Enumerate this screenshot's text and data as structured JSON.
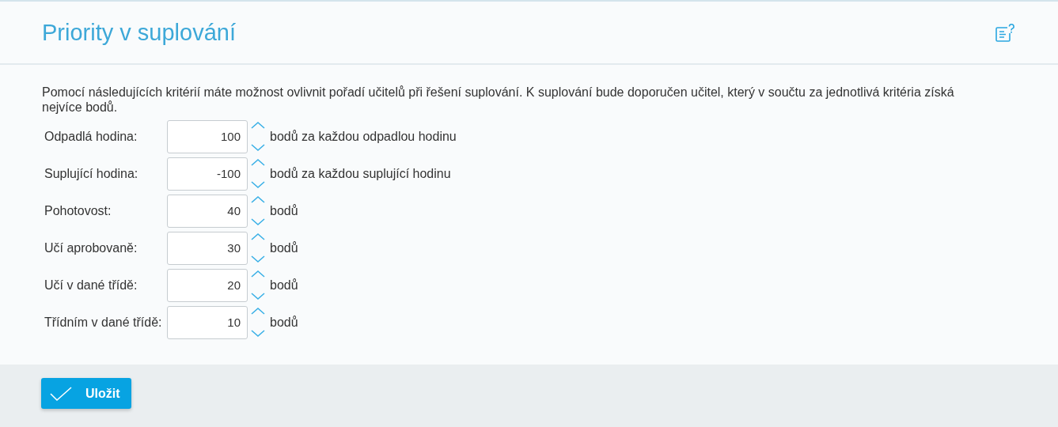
{
  "title": "Priority v suplování",
  "description": "Pomocí následujících kritérií máte možnost ovlivnit pořadí učitelů při řešení suplování. K suplování bude doporučen učitel, který v součtu za jednotlivá kritéria získá nejvíce bodů.",
  "criteria": [
    {
      "label": "Odpadlá hodina:",
      "value": "100",
      "unit": "bodů za každou odpadlou hodinu"
    },
    {
      "label": "Suplující hodina:",
      "value": "-100",
      "unit": "bodů za každou suplující hodinu"
    },
    {
      "label": "Pohotovost:",
      "value": "40",
      "unit": "bodů"
    },
    {
      "label": "Učí aprobovaně:",
      "value": "30",
      "unit": "bodů"
    },
    {
      "label": "Učí v dané třídě:",
      "value": "20",
      "unit": "bodů"
    },
    {
      "label": "Třídním v dané třídě:",
      "value": "10",
      "unit": "bodů"
    }
  ],
  "save_button": "Uložit"
}
